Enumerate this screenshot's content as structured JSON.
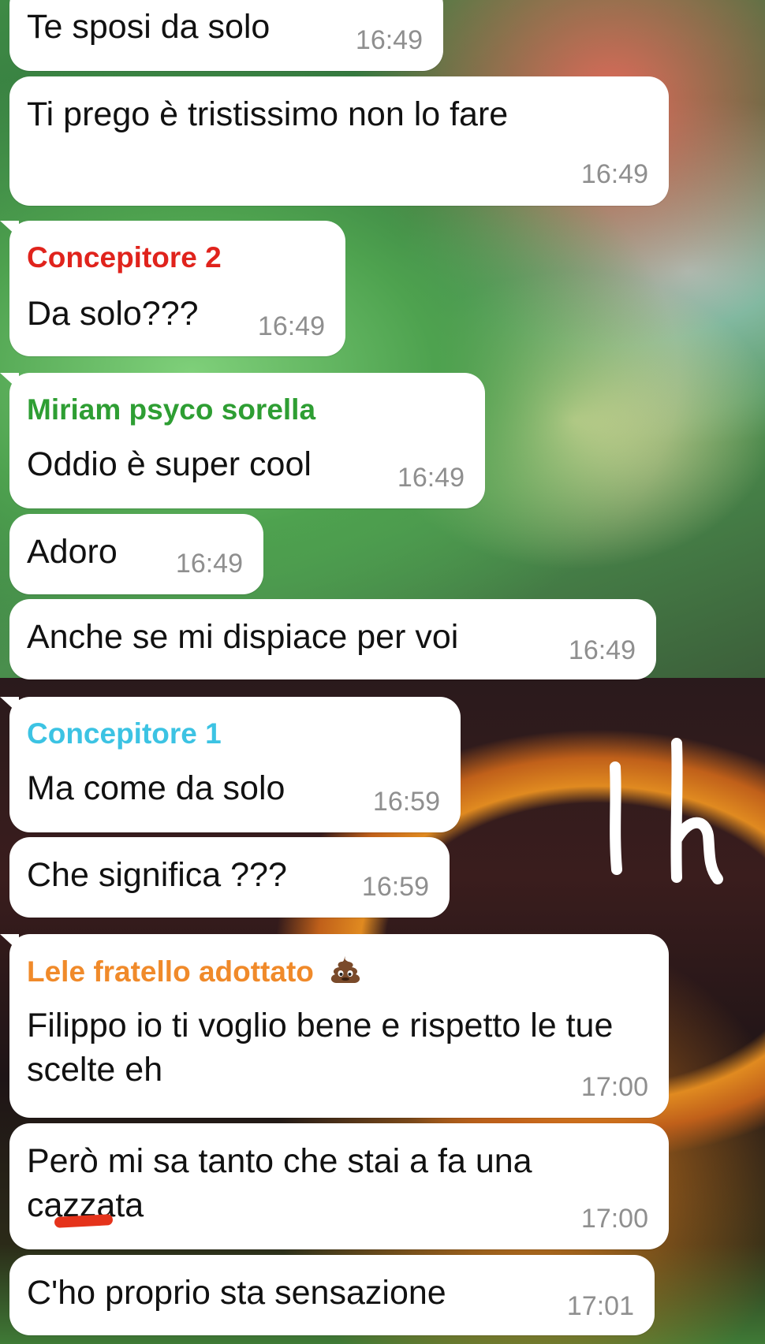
{
  "chat": {
    "messages": [
      {
        "text": "Te sposi da solo",
        "time": "16:49"
      },
      {
        "text": "Ti prego è tristissimo non lo fare",
        "time": "16:49"
      },
      {
        "sender": "Concepitore 2",
        "sender_color": "#e0231c",
        "text": "Da solo???",
        "time": "16:49"
      },
      {
        "sender": "Miriam psyco sorella",
        "sender_color": "#2e9e33",
        "text": "Oddio è super cool",
        "time": "16:49"
      },
      {
        "text": "Adoro",
        "time": "16:49"
      },
      {
        "text": "Anche se mi dispiace per voi",
        "time": "16:49"
      },
      {
        "sender": "Concepitore 1",
        "sender_color": "#3cc3e3",
        "text": "Ma come da solo",
        "time": "16:59"
      },
      {
        "text": "Che significa ???",
        "time": "16:59"
      },
      {
        "sender": "Lele fratello adottato",
        "sender_emoji": "poop-icon",
        "sender_color": "#f08a2a",
        "text": "Filippo io ti voglio bene e rispetto le tue scelte eh",
        "time": "17:00"
      },
      {
        "text": "Però mi sa tanto che stai a fa una",
        "text2": "cazzata",
        "time": "17:00"
      },
      {
        "text": "C'ho proprio sta sensazione",
        "time": "17:01"
      }
    ]
  },
  "colors": {
    "bubble": "#ffffff",
    "timestamp": "#8f8f8f",
    "redaction": "#e5331b",
    "scribble": "#ffffff"
  }
}
